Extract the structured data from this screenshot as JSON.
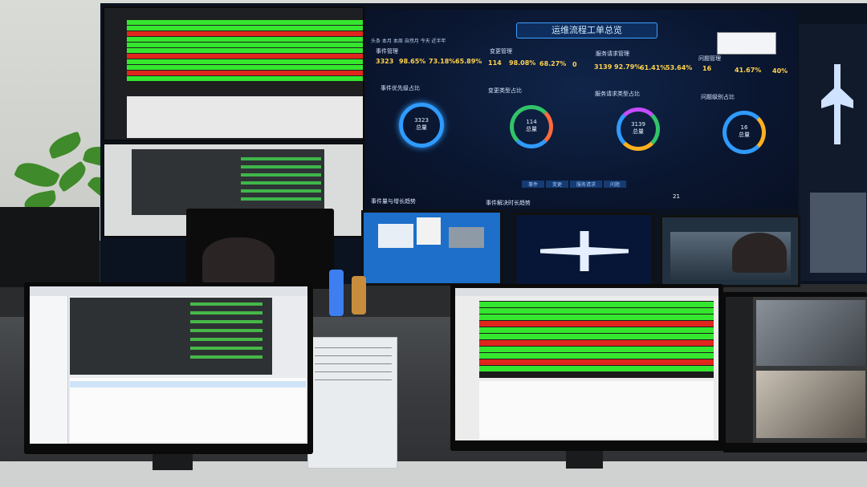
{
  "dashboard": {
    "title": "运维流程工单总览",
    "filters": "头条  本月  本周  自然月  今天   近半年",
    "sections": [
      "事件管理",
      "变更管理",
      "服务请求管理",
      "问题管理"
    ],
    "kpis": [
      "3323",
      "98.65%",
      "73.18%",
      "65.89%",
      "114",
      "98.08%",
      "68.27%",
      "0",
      "3139",
      "92.79%",
      "61.41%",
      "53.64%",
      "16",
      "41.67%",
      "40%"
    ],
    "panels": [
      "事件优先级占比",
      "变更类型占比",
      "服务请求类型占比",
      "问题级别占比"
    ],
    "rings": [
      {
        "value": "3323",
        "unit": "总量",
        "color": "#2f9bff"
      },
      {
        "value": "114",
        "unit": "总量",
        "color": "#31c46a"
      },
      {
        "value": "3139",
        "unit": "总量",
        "color": "#c44cff"
      },
      {
        "value": "16",
        "unit": "总量",
        "color": "#ffb020"
      }
    ],
    "tabs": [
      "事件",
      "变更",
      "服务请求",
      "问题"
    ],
    "bottom_left": "事件量与增长趋势",
    "bottom_mid": "事件解决时长趋势",
    "bottom_count": "21"
  },
  "colors": {
    "green_row": "#35e62f",
    "red_row": "#e0261c",
    "dash_bg": "#0a1630",
    "accent": "#3da0ff"
  }
}
